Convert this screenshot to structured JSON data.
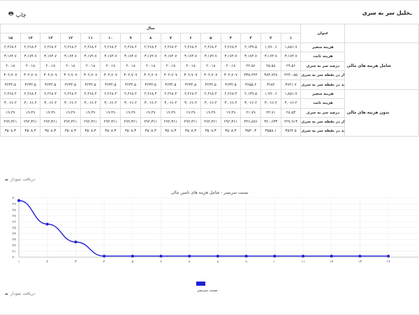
{
  "header": {
    "title": "ـحلیل سر به سری",
    "print_label": "چاپ",
    "print_icon": "printer-icon"
  },
  "table": {
    "label_header": "عنوان",
    "year_header": "سال",
    "years": [
      "۱",
      "۲",
      "۳",
      "۴",
      "۵",
      "۶",
      "۷",
      "۸",
      "۹",
      "۱۰",
      "۱۱",
      "۱۲",
      "۱۳",
      "۱۴",
      "۱۵"
    ],
    "groups": [
      {
        "name": "شامل هزینه های مالی",
        "rows": [
          {
            "label": "هزینه متغیر",
            "values": [
              "۱,۸۵۱.۷",
              "۱,۹۹۰.۶",
              "۲,۱۳۹.۵",
              "۲,۲۶۸.۴",
              "۲,۲۶۸.۴",
              "۲,۲۶۸.۴",
              "۲,۲۶۸.۴",
              "۲,۲۶۸.۴",
              "۲,۲۶۸.۴",
              "۲,۲۶۸.۴",
              "۲,۲۶۸.۴",
              "۲,۲۶۸.۴",
              "۲,۲۶۸.۴",
              "۲,۲۶۸.۴",
              "۲,۲۶۸.۴"
            ]
          },
          {
            "label": "هزینه ثابت",
            "values": [
              "۳,۱۷۴.۷",
              "۳,۱۷۴.۷",
              "۳,۱۷۴.۷",
              "۳,۱۷۴.۷",
              "۳,۱۷۴.۷",
              "۳,۱۷۴.۷",
              "۳,۱۷۴.۷",
              "۳,۱۷۴.۷",
              "۳,۱۷۴.۷",
              "۳,۱۷۴.۷",
              "۳,۱۷۴.۷",
              "۳,۱۷۴.۷",
              "۳,۱۷۴.۷",
              "۳,۱۷۴.۷",
              "۳,۱۷۴.۷"
            ]
          },
          {
            "label": "درصد سر به سری",
            "values": [
              "۲۹.۵۶",
              "۲۵.۵۸",
              "۲۲.۵۶",
              "۲۰.۱۸",
              "۲۰.۱۸",
              "۲۰.۱۸",
              "۲۰.۱۸",
              "۲۰.۱۸",
              "۲۰.۱۸",
              "۲۰.۱۸",
              "۲۰.۱۸",
              "۲۰.۱۸",
              "۲۰.۱۸",
              "۲۰.۱۸",
              "۲۰.۱۸"
            ]
          },
          {
            "label": "مقدار در نقطه سر به سری",
            "values": [
              "۴۴۳,۰۵۵",
              "۳۸۳,۷۴۸",
              "۳۳۸,۴۴۴",
              "۳۰۲,۷۰۷",
              "۳۰۲,۷۰۷",
              "۳۰۲,۷۰۷",
              "۳۰۲,۷۰۷",
              "۳۰۲,۷۰۷",
              "۳۰۲,۷۰۷",
              "۳۰۲,۷۰۷",
              "۳۰۲,۷۰۷",
              "۳۰۲,۷۰۷",
              "۳۰۲,۷۰۷",
              "۳۰۲,۷۰۷",
              "۳۰۲,۷۰۷"
            ]
          },
          {
            "label": "درآمد در نقطه سر به سری",
            "values": [
              "۳۷۲۱.۷",
              "۳۶۸۴",
              "۳۶۵۵.۲",
              "۳۶۳۲.۵",
              "۳۶۳۲.۵",
              "۳۶۳۲.۵",
              "۳۶۳۲.۵",
              "۳۶۳۲.۵",
              "۳۶۳۲.۵",
              "۳۶۳۲.۵",
              "۳۶۳۲.۵",
              "۳۶۳۲.۵",
              "۳۶۳۲.۵",
              "۳۶۳۲.۵",
              "۳۶۳۲.۵"
            ]
          }
        ]
      },
      {
        "name": "بدون هزینه های مالی",
        "rows": [
          {
            "label": "هزینه متغیر",
            "values": [
              "۱,۸۵۱.۷",
              "۱,۹۹۰.۶",
              "۲,۱۳۹.۵",
              "۲,۲۶۸.۴",
              "۲,۲۶۸.۴",
              "۲,۲۶۸.۴",
              "۲,۲۶۸.۴",
              "۲,۲۶۸.۴",
              "۲,۲۶۸.۴",
              "۲,۲۶۸.۴",
              "۲,۲۶۸.۴",
              "۲,۲۶۸.۴",
              "۲,۲۶۸.۴",
              "۲,۲۶۸.۴",
              "۲,۲۶۸.۴"
            ]
          },
          {
            "label": "هزینه ثابت",
            "values": [
              "۳,۰۶۶.۲",
              "۳,۰۶۶.۲",
              "۳,۰۶۶.۲",
              "۳,۰۶۶.۲",
              "۳,۰۶۶.۲",
              "۳,۰۶۶.۲",
              "۳,۰۶۶.۲",
              "۳,۰۶۶.۲",
              "۳,۰۶۶.۲",
              "۳,۰۶۶.۲",
              "۳,۰۶۶.۲",
              "۳,۰۶۶.۲",
              "۳,۰۶۶.۲",
              "۳,۰۶۶.۲",
              "۳,۰۶۶.۲"
            ]
          },
          {
            "label": "درصد سر به سری",
            "values": [
              "۲۸.۵۳",
              "۲۴.۷۱",
              "۲۱.۷۹",
              "۱۹.۴۹",
              "۱۹.۴۹",
              "۱۹.۴۹",
              "۱۹.۴۹",
              "۱۹.۴۹",
              "۱۹.۴۹",
              "۱۹.۴۹",
              "۱۹.۴۹",
              "۱۹.۴۹",
              "۱۹.۴۹",
              "۱۹.۴۹",
              "۱۹.۴۹"
            ]
          },
          {
            "label": "مقدار در نقطه سر به سری",
            "values": [
              "۴۲۷,۹۱۳",
              "۳۷۰,۶۳۳",
              "۳۲۶,۸۷۶",
              "۲۹۲,۳۶۱",
              "۲۹۲,۳۶۱",
              "۲۹۲,۳۶۱",
              "۲۹۲,۳۶۱",
              "۲۹۲,۳۶۱",
              "۲۹۲,۳۶۱",
              "۲۹۲,۳۶۱",
              "۲۹۲,۳۶۱",
              "۲۹۲,۳۶۱",
              "۲۹۲,۳۶۱",
              "۲۹۲,۳۶۱",
              "۲۹۲,۳۶۱"
            ]
          },
          {
            "label": "درآمد در نقطه سر به سری",
            "values": [
              "۳۵۹۴.۵",
              "۳۵۵۸.۱",
              "۳۵۳۰.۳",
              "۳۵۰۸.۳",
              "۳۵۰۸.۳",
              "۳۵۰۸.۳",
              "۳۵۰۸.۳",
              "۳۵۰۸.۳",
              "۳۵۰۸.۳",
              "۳۵۰۸.۳",
              "۳۵۰۸.۳",
              "۳۵۰۸.۳",
              "۳۵۰۸.۳",
              "۳۵۰۸.۳",
              "۳۵۰۸.۳"
            ]
          }
        ]
      }
    ]
  },
  "download_top": {
    "label": "دریافت نمودار",
    "icon": "cloud-download-icon"
  },
  "download_bottom": {
    "label": "دریافت نمودار",
    "icon": "cloud-download-icon"
  },
  "chart_data": {
    "type": "line",
    "title": "نسبت سربسر - شامل هزینه های تامین مالی",
    "x": [
      "۱",
      "۲",
      "۳",
      "۴",
      "۵",
      "۶",
      "۷",
      "۸",
      "۹",
      "۱۰",
      "۱۱",
      "۱۲",
      "۱۳",
      "۱۴"
    ],
    "series": [
      {
        "name": "نسبت سربسر",
        "values": [
          29.56,
          25.58,
          22.56,
          20.18,
          20.18,
          20.18,
          20.18,
          20.18,
          20.18,
          20.18,
          20.18,
          20.18,
          20.18,
          20.18
        ],
        "color": "#1f1fd6"
      }
    ],
    "ylim": [
      20,
      30
    ],
    "yticks": [
      "۲۰",
      "۲۱",
      "۲۲",
      "۲۳",
      "۲۴",
      "۲۵",
      "۲۶",
      "۲۷",
      "۲۸",
      "۲۹",
      "۳۰"
    ],
    "grid": true,
    "legend": "bottom"
  }
}
